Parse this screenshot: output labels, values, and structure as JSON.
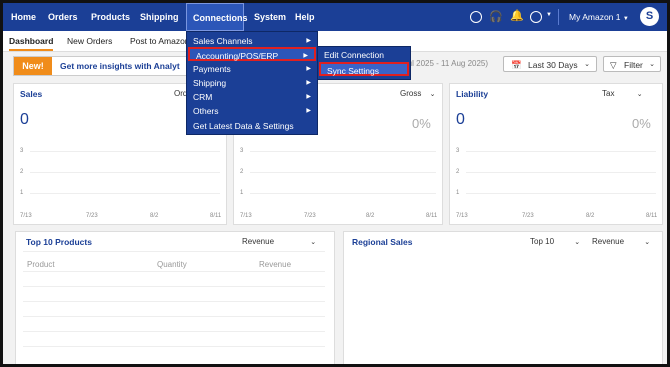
{
  "nav": {
    "items": [
      "Home",
      "Orders",
      "Products",
      "Shipping",
      "Connections",
      "System",
      "Help"
    ],
    "account": "My Amazon 1",
    "avatar_letter": "S"
  },
  "subnav": {
    "tabs": [
      "Dashboard",
      "New Orders",
      "Post to Amazon"
    ]
  },
  "banner": {
    "badge": "New!",
    "text": "Get more insights with Analyt"
  },
  "toolbar": {
    "date_range": "Jul 2025 - 11 Aug 2025)",
    "period": "Last 30 Days",
    "filter": "Filter"
  },
  "cards": {
    "sales": {
      "title": "Sales",
      "select": "Ord",
      "value": "0"
    },
    "middle": {
      "select": "Gross",
      "value": "0%"
    },
    "liability": {
      "title": "Liability",
      "select": "Tax",
      "value": "0",
      "pct": "0%"
    },
    "y_ticks": [
      "3",
      "2",
      "1"
    ],
    "x_ticks": [
      "7/13",
      "7/23",
      "8/2",
      "8/11"
    ]
  },
  "top_products": {
    "title": "Top 10 Products",
    "select": "Revenue",
    "columns": [
      "Product",
      "Quantity",
      "Revenue"
    ]
  },
  "regional": {
    "title": "Regional Sales",
    "top_select": "Top 10",
    "metric_select": "Revenue"
  },
  "connections_menu": {
    "items": [
      "Sales Channels",
      "Accounting/POS/ERP",
      "Payments",
      "Shipping",
      "CRM",
      "Others",
      "Get Latest Data & Settings"
    ]
  },
  "submenu": {
    "items": [
      "Edit Connection",
      "Sync Settings"
    ]
  }
}
